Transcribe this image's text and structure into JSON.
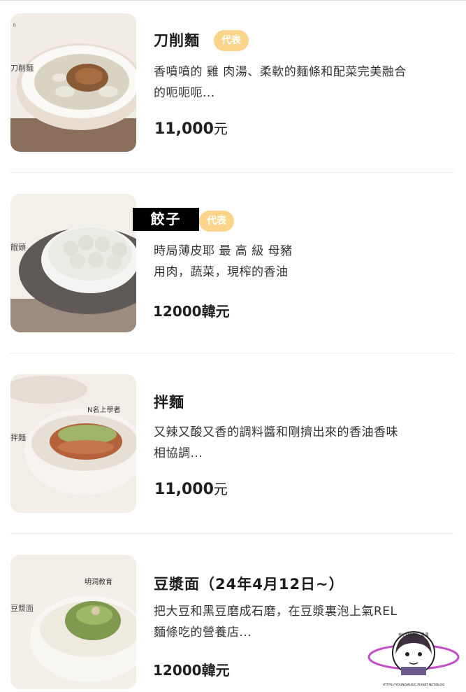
{
  "items": [
    {
      "name": "刀削麵",
      "badge": "代表",
      "desc_line1": "香噴噴的 雞 肉湯、柔軟的麵條和配菜完美融合",
      "desc_line2": "的呃呃呃...",
      "price_number": "11,000",
      "price_unit": "元",
      "photo_label": "刀削麵"
    },
    {
      "name": "餃子",
      "badge": "代表",
      "desc_line1": "時局薄皮耶 最 高 級 母豬",
      "desc_line2": "用肉，蔬菜，現榨的香油",
      "price_number": "12000",
      "price_unit": "韓元",
      "photo_label": "餛頭"
    },
    {
      "name": "拌麵",
      "badge": "",
      "desc_line1": "又辣又酸又香的調料醬和剛擠出來的香油香味",
      "desc_line2": "相協調...",
      "price_number": "11,000",
      "price_unit": "元",
      "photo_label": "拌麵",
      "photo_sign": "N名上學者"
    },
    {
      "name": "豆漿面（24年4月12日~）",
      "badge": "",
      "desc_line1": "把大豆和黑豆磨成石磨，在豆漿裏泡上氣REL",
      "desc_line2": "麵條吃的營養店...",
      "price_number": "12000",
      "price_unit": "韓元",
      "photo_label": "豆漿面",
      "photo_sign": "明洞教育"
    }
  ],
  "watermark": {
    "top_text": "HI, I'M MS.溫溫",
    "bottom_text": "HTTPS://YOUNGMUSIC.PIXNET.NET/BLOG"
  },
  "colors": {
    "badge_bg": "#fbd48a",
    "divider": "#ececec",
    "text": "#222222"
  }
}
